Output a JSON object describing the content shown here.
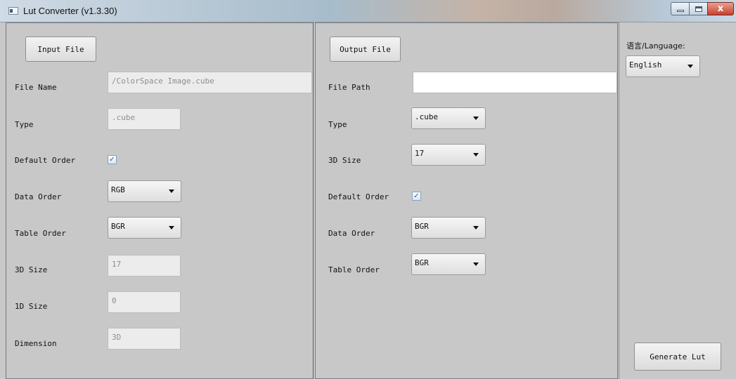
{
  "window": {
    "title": "Lut Converter (v1.3.30)",
    "close_glyph": "x"
  },
  "input": {
    "button": "Input File",
    "file_name_label": "File Name",
    "file_name_value": "/ColorSpace Image.cube",
    "type_label": "Type",
    "type_value": ".cube",
    "default_order_label": "Default Order",
    "default_order_checked": "✓",
    "data_order_label": "Data Order",
    "data_order_value": "RGB",
    "table_order_label": "Table Order",
    "table_order_value": "BGR",
    "size3d_label": "3D Size",
    "size3d_value": "17",
    "size1d_label": "1D Size",
    "size1d_value": "0",
    "dimension_label": "Dimension",
    "dimension_value": "3D"
  },
  "output": {
    "button": "Output File",
    "file_path_label": "File Path",
    "file_path_value": "",
    "type_label": "Type",
    "type_value": ".cube",
    "size3d_label": "3D Size",
    "size3d_value": "17",
    "default_order_label": "Default Order",
    "default_order_checked": "✓",
    "data_order_label": "Data Order",
    "data_order_value": "BGR",
    "table_order_label": "Table Order",
    "table_order_value": "BGR"
  },
  "settings": {
    "language_label": "语言/Language:",
    "language_value": "English",
    "generate_button": "Generate Lut"
  }
}
